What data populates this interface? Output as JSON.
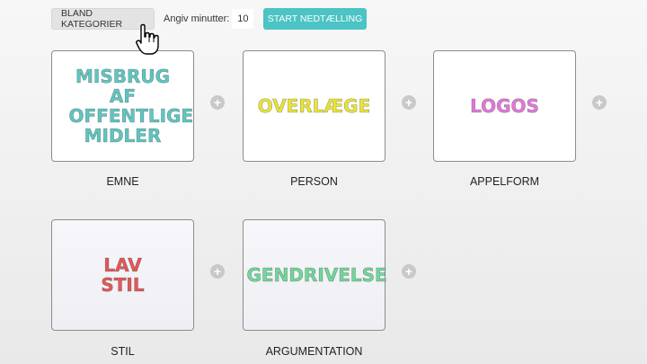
{
  "toolbar": {
    "shuffle_label": "BLAND KATEGORIER",
    "minutes_label": "Angiv minutter:",
    "minutes_value": "10",
    "start_label": "START NEDTÆLLING"
  },
  "cards": [
    {
      "text": "MISBRUG AF OFFENTLIGE MIDLER",
      "category": "EMNE",
      "color": "#5fc6c0"
    },
    {
      "text": "OVERLÆGE",
      "category": "PERSON",
      "color": "#e8e43a"
    },
    {
      "text": "LOGOS",
      "category": "APPELFORM",
      "color": "#e07ad8"
    },
    {
      "text": "LAV STIL",
      "category": "STIL",
      "color": "#e05a5a"
    },
    {
      "text": "GENDRIVELSE",
      "category": "ARGUMENTATION",
      "color": "#72d69a"
    }
  ]
}
